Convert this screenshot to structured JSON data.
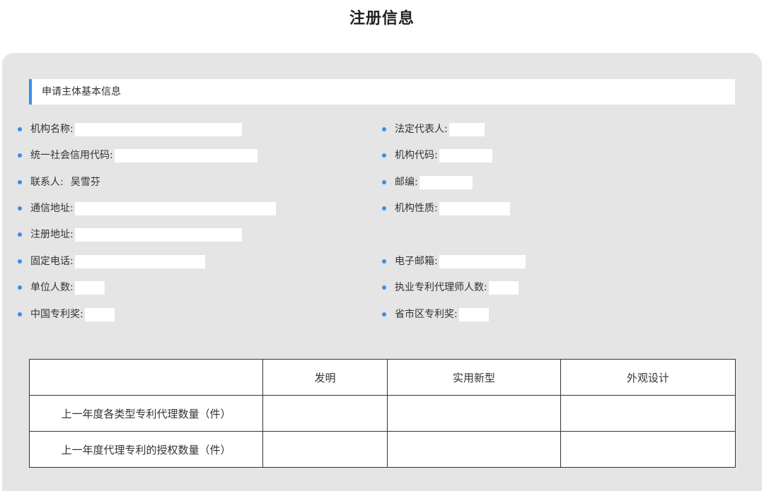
{
  "page_title": "注册信息",
  "section_title": "申请主体基本信息",
  "fields": [
    {
      "label": "机构名称:",
      "value": ""
    },
    {
      "label": "法定代表人:",
      "value": ""
    },
    {
      "label": "统一社会信用代码:",
      "value": ""
    },
    {
      "label": "机构代码:",
      "value": ""
    },
    {
      "label": "联系人:",
      "value": "吴雪芬"
    },
    {
      "label": "邮编:",
      "value": ""
    },
    {
      "label": "通信地址:",
      "value": ""
    },
    {
      "label": "机构性质:",
      "value": ""
    },
    {
      "label": "注册地址:",
      "value": ""
    },
    {
      "label": "固定电话:",
      "value": ""
    },
    {
      "label": "电子邮箱:",
      "value": ""
    },
    {
      "label": "单位人数:",
      "value": ""
    },
    {
      "label": "执业专利代理师人数:",
      "value": ""
    },
    {
      "label": "中国专利奖:",
      "value": ""
    },
    {
      "label": "省市区专利奖:",
      "value": ""
    }
  ],
  "table": {
    "headers": [
      "",
      "发明",
      "实用新型",
      "外观设计"
    ],
    "rows": [
      {
        "label": "上一年度各类型专利代理数量（件）",
        "values": [
          "",
          "",
          ""
        ]
      },
      {
        "label": "上一年度代理专利的授权数量（件）",
        "values": [
          "",
          "",
          ""
        ]
      }
    ]
  },
  "colors": {
    "accent": "#3a8ee6",
    "panel_bg": "#e5e5e5"
  }
}
